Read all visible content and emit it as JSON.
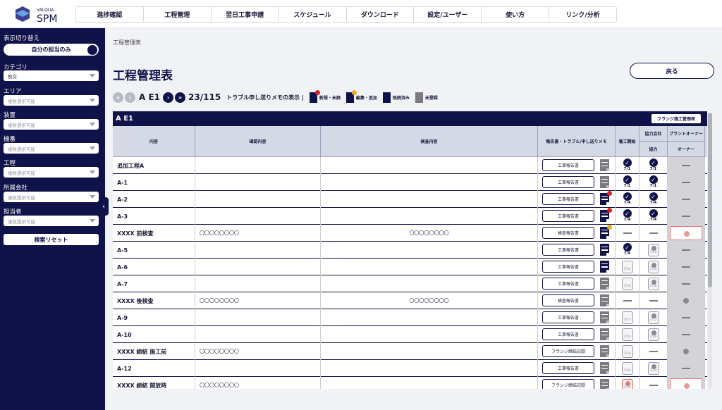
{
  "header": {
    "logo_top": "VALQUA",
    "logo_main": "SPM",
    "nav": [
      "進捗確認",
      "工程管理",
      "翌日工事申請",
      "スケジュール",
      "ダウンロード",
      "設定/ユーザー",
      "使い方",
      "リンク/分析"
    ]
  },
  "sidebar": {
    "display_switch_label": "表示切り替え",
    "toggle_label": "自分の担当のみ",
    "category_label": "カテゴリ",
    "category_value": "熱交",
    "area_label": "エリア",
    "area_placeholder": "複数選択可能",
    "equipment_label": "装置",
    "equipment_placeholder": "複数選択可能",
    "machine_label": "機番",
    "machine_placeholder": "複数選択可能",
    "process_label": "工程",
    "process_placeholder": "複数選択可能",
    "company_label": "所属会社",
    "company_placeholder": "複数選択可能",
    "person_label": "担当者",
    "person_placeholder": "複数選択可能",
    "reset_label": "検索リセット"
  },
  "breadcrumb": "工程管理表",
  "page_title": "工程管理表",
  "back_label": "戻る",
  "pager": {
    "name": "A E1",
    "count": "23/115",
    "memo_label": "トラブル申し送りメモの表示 |",
    "legend": [
      "新規・未読",
      "編集・追加",
      "既読済み",
      "未登録"
    ]
  },
  "table": {
    "title": "A E1",
    "flange_button": "フランジ施工管理表",
    "headers": {
      "content": "内容",
      "check": "確認内容",
      "inspection": "検査内容",
      "report": "報告書・トラブル/申し送りメモ",
      "start": "着工開始",
      "coop_top": "協力会社",
      "coop": "協力",
      "owner_top": "プラントオーナー",
      "owner": "オーナー"
    },
    "rows": [
      {
        "name": "追加工程A",
        "check": "",
        "insp": "",
        "report": "工事報告書",
        "doc": "gray",
        "badge": "",
        "start": {
          "t": "chk",
          "d": "7/1"
        },
        "coop": {
          "t": "chk",
          "d": "7/1"
        },
        "owner": "dash"
      },
      {
        "name": "A-1",
        "check": "",
        "insp": "",
        "report": "工事報告書",
        "doc": "gray",
        "badge": "",
        "start": {
          "t": "chk",
          "d": "7/1"
        },
        "coop": {
          "t": "chk",
          "d": "7/1"
        },
        "owner": "dash"
      },
      {
        "name": "A-2",
        "check": "",
        "insp": "",
        "report": "工事報告書",
        "doc": "navy",
        "badge": "r",
        "start": {
          "t": "chk",
          "d": "7/4"
        },
        "coop": {
          "t": "chk",
          "d": "7/4"
        },
        "owner": "dash"
      },
      {
        "name": "A-3",
        "check": "",
        "insp": "",
        "report": "工事報告書",
        "doc": "navy",
        "badge": "r",
        "start": {
          "t": "chk",
          "d": "7/4"
        },
        "coop": {
          "t": "chk",
          "d": "7/4"
        },
        "owner": "dash"
      },
      {
        "name": "XXXX 前検査",
        "check": "〇〇〇〇〇〇〇〇",
        "insp": "〇〇〇〇〇〇〇〇",
        "report": "検査報告書",
        "doc": "navy",
        "badge": "y",
        "start": {
          "t": "dash",
          "d": ""
        },
        "coop": {
          "t": "dash",
          "d": ""
        },
        "owner": "red"
      },
      {
        "name": "A-5",
        "check": "",
        "insp": "",
        "report": "工事報告書",
        "doc": "navy",
        "badge": "",
        "start": {
          "t": "chk",
          "d": "7/4"
        },
        "coop": {
          "t": "pend",
          "d": "7/11"
        },
        "owner": "dash"
      },
      {
        "name": "A-6",
        "check": "",
        "insp": "",
        "report": "工事報告書",
        "doc": "navy",
        "badge": "",
        "start": {
          "t": "pend0",
          "d": "7/14"
        },
        "coop": {
          "t": "pend",
          "d": "7/14"
        },
        "owner": "dash"
      },
      {
        "name": "A-7",
        "check": "",
        "insp": "",
        "report": "工事報告書",
        "doc": "gray",
        "badge": "",
        "start": {
          "t": "pend0",
          "d": "7/16"
        },
        "coop": {
          "t": "pend",
          "d": "7/16"
        },
        "owner": "dash"
      },
      {
        "name": "XXXX 後検査",
        "check": "〇〇〇〇〇〇〇〇",
        "insp": "〇〇〇〇〇〇〇〇",
        "report": "検査報告書",
        "doc": "gray",
        "badge": "",
        "start": {
          "t": "dash",
          "d": ""
        },
        "coop": {
          "t": "dash",
          "d": ""
        },
        "owner": "gdot"
      },
      {
        "name": "A-9",
        "check": "",
        "insp": "",
        "report": "工事報告書",
        "doc": "gray",
        "badge": "",
        "start": {
          "t": "pend0",
          "d": "7/17"
        },
        "coop": {
          "t": "pend",
          "d": "7/17"
        },
        "owner": "dash"
      },
      {
        "name": "A-10",
        "check": "",
        "insp": "",
        "report": "工事報告書",
        "doc": "gray",
        "badge": "",
        "start": {
          "t": "pend0",
          "d": "7/20"
        },
        "coop": {
          "t": "pend",
          "d": "7/20"
        },
        "owner": "dash"
      },
      {
        "name": "XXXX 締結 施工前",
        "check": "〇〇〇〇〇〇〇〇",
        "insp": "",
        "report": "フランジ締結記録",
        "doc": "gray",
        "badge": "",
        "start": {
          "t": "pend0",
          "d": "7/24"
        },
        "coop": {
          "t": "dash",
          "d": ""
        },
        "owner": "gdot"
      },
      {
        "name": "A-12",
        "check": "",
        "insp": "",
        "report": "工事報告書",
        "doc": "gray",
        "badge": "",
        "start": {
          "t": "pend0",
          "d": "7/24"
        },
        "coop": {
          "t": "pend",
          "d": "7/24"
        },
        "owner": "dash"
      },
      {
        "name": "XXXX 締結 開放時",
        "check": "〇〇〇〇〇〇〇〇",
        "insp": "",
        "report": "フランジ締結記録",
        "doc": "gray",
        "badge": "",
        "start": {
          "t": "pendr",
          "d": "7/24"
        },
        "coop": {
          "t": "dash",
          "d": ""
        },
        "owner": "red"
      }
    ]
  }
}
